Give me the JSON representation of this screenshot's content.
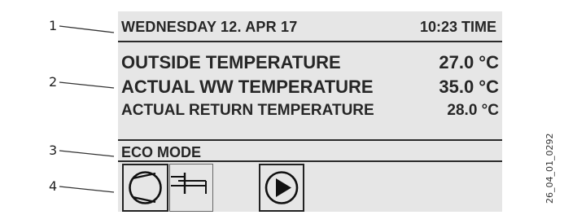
{
  "callouts": [
    "1",
    "2",
    "3",
    "4"
  ],
  "display": {
    "date": "WEDNESDAY  12. APR 17",
    "time": "10:23 TIME",
    "measurements": [
      {
        "label": "OUTSIDE TEMPERATURE",
        "value": "27.0 °C"
      },
      {
        "label": "ACTUAL WW TEMPERATURE",
        "value": "35.0 °C"
      },
      {
        "label": "ACTUAL RETURN TEMPERATURE",
        "value": "28.0 °C"
      }
    ],
    "mode": "ECO MODE",
    "icons": [
      "compressor-icon",
      "tap-icon",
      "pump-icon"
    ]
  },
  "doc_ref": "26_04_01_0292"
}
